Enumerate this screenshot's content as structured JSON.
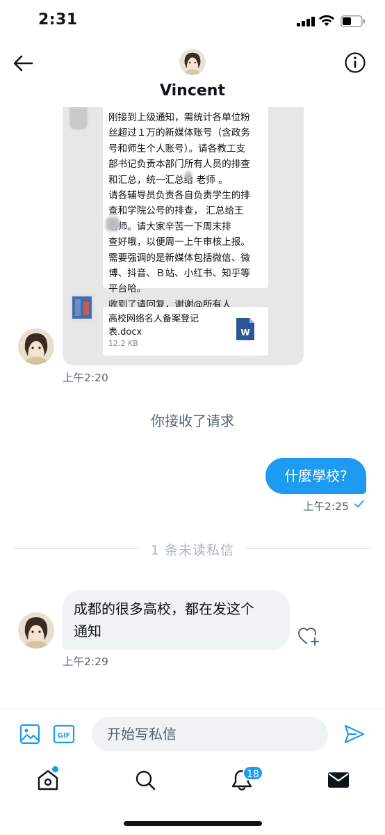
{
  "status_bar": {
    "time": "2:31"
  },
  "header": {
    "name": "Vincent",
    "back_icon": "arrow-left-icon",
    "info_icon": "info-icon"
  },
  "conversation": {
    "image_message": {
      "wechat_text_lines": [
        "刚接到上级通知，需统计各单位粉",
        "丝超过１万的新媒体账号（含政务",
        "号和师生个人账号）。请各教工支",
        "部书记负责本部门所有人员的排查",
        "和汇总，统一汇总给      老师 。",
        "请各辅导员负责各自负责学生的排",
        "查和学院公号的排查，  汇总给王",
        "       老师。请大家辛苦一下周末排",
        "查好哦，以便周一上午审核上报。",
        "需要强调的是新媒体包括微信、微",
        "博、抖音、Ｂ站、小红书、知乎等",
        "平台哈。",
        "收到了请回复，谢谢@所有人"
      ],
      "sender_label": "老师",
      "file": {
        "name": "高校网络名人备案登记表.docx",
        "size": "12.2 KB",
        "icon": "word-doc-icon"
      },
      "timestamp": "上午2:20"
    },
    "system_message": "你接收了请求",
    "outgoing": {
      "text": "什麼學校?",
      "timestamp": "上午2:25",
      "status_icon": "check-icon"
    },
    "unread_divider": "1 条未读私信",
    "incoming": {
      "text_lines": [
        "成都的很多高校，都在发这个",
        "通知"
      ],
      "timestamp": "上午2:29"
    }
  },
  "composer": {
    "placeholder": "开始写私信",
    "image_icon": "image-icon",
    "gif_label": "GIF",
    "send_icon": "send-icon"
  },
  "bottom_nav": {
    "items": [
      "home-icon",
      "search-icon",
      "bell-icon",
      "mail-icon"
    ],
    "notification_count": "18"
  },
  "colors": {
    "accent": "#1d9bf0",
    "text_secondary": "#536471",
    "bubble_incoming": "#eff3f4"
  }
}
